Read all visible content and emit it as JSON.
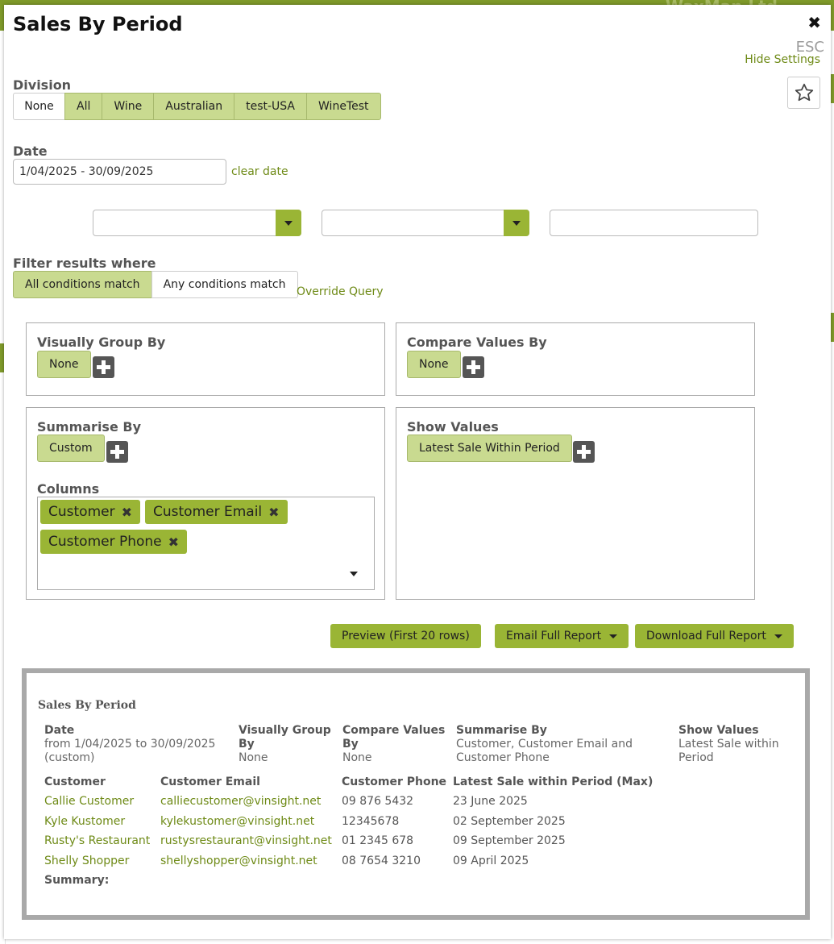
{
  "background": {
    "brand_faint": "WaxMan Ltd"
  },
  "modal": {
    "title": "Sales By Period",
    "close_glyph": "✖",
    "esc_label": "ESC",
    "hide_settings_label": "Hide Settings"
  },
  "division": {
    "label": "Division",
    "options": [
      "None",
      "All",
      "Wine",
      "Australian",
      "test-USA",
      "WineTest"
    ],
    "selected": [
      "All",
      "Wine",
      "Australian",
      "test-USA",
      "WineTest"
    ]
  },
  "date": {
    "label": "Date",
    "value": "1/04/2025 - 30/09/2025",
    "clear_label": "clear date"
  },
  "filter": {
    "label": "Filter results where",
    "options": [
      "All conditions match",
      "Any conditions match"
    ],
    "selected": "All conditions match",
    "override_label": "Override Query"
  },
  "visually_group_by": {
    "title": "Visually Group By",
    "value": "None"
  },
  "compare_values_by": {
    "title": "Compare Values By",
    "value": "None"
  },
  "summarise_by": {
    "title": "Summarise By",
    "value": "Custom"
  },
  "columns": {
    "title": "Columns",
    "tags": [
      "Customer",
      "Customer Email",
      "Customer Phone"
    ],
    "remove_glyph": "✖"
  },
  "show_values": {
    "title": "Show Values",
    "value": "Latest Sale Within Period"
  },
  "actions": {
    "preview_label": "Preview (First 20 rows)",
    "email_label": "Email Full Report",
    "download_label": "Download Full Report"
  },
  "report": {
    "title": "Sales By Period",
    "meta": {
      "date_h": "Date",
      "date_v": "from 1/04/2025 to 30/09/2025 (custom)",
      "vgroup_h": "Visually Group By",
      "vgroup_v": "None",
      "compare_h": "Compare Values By",
      "compare_v": "None",
      "summ_h": "Summarise By",
      "summ_v": "Customer, Customer Email and Customer Phone",
      "show_h": "Show Values",
      "show_v": "Latest Sale within Period"
    },
    "columns": [
      "Customer",
      "Customer Email",
      "Customer Phone",
      "Latest Sale within Period (Max)"
    ],
    "rows": [
      [
        "Callie Customer",
        "calliecustomer@vinsight.net",
        "09 876 5432",
        "23 June 2025"
      ],
      [
        "Kyle Kustomer",
        "kylekustomer@vinsight.net",
        "12345678",
        "02 September 2025"
      ],
      [
        "Rusty's Restaurant",
        "rustysrestaurant@vinsight.net",
        "01 2345 678",
        "09 September 2025"
      ],
      [
        "Shelly Shopper",
        "shellyshopper@vinsight.net",
        "08 7654 3210",
        "09 April 2025"
      ]
    ],
    "summary_label": "Summary:"
  },
  "colors": {
    "brand": "#7f9a2a",
    "accent": "#9ab535",
    "selected_fill": "#c9da90",
    "link": "#6e8a16"
  }
}
